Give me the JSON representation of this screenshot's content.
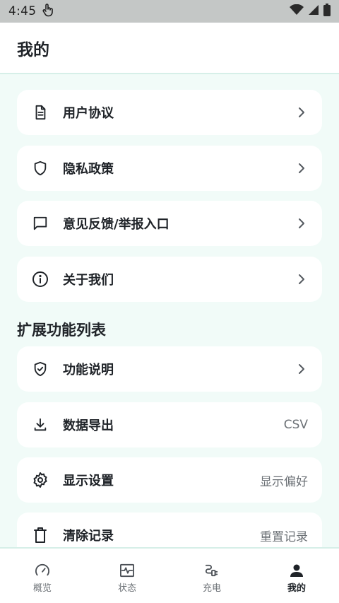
{
  "status_bar": {
    "time": "4:45"
  },
  "header": {
    "title": "我的"
  },
  "menu": [
    {
      "label": "用户协议",
      "icon": "document-icon",
      "chevron": true
    },
    {
      "label": "隐私政策",
      "icon": "shield-icon",
      "chevron": true
    },
    {
      "label": "意见反馈/举报入口",
      "icon": "message-icon",
      "chevron": true
    },
    {
      "label": "关于我们",
      "icon": "info-icon",
      "chevron": true
    }
  ],
  "section": {
    "title": "扩展功能列表"
  },
  "extensions": [
    {
      "label": "功能说明",
      "icon": "shield-check-icon",
      "chevron": true
    },
    {
      "label": "数据导出",
      "icon": "download-icon",
      "value": "CSV"
    },
    {
      "label": "显示设置",
      "icon": "gear-icon",
      "value": "显示偏好"
    },
    {
      "label": "清除记录",
      "icon": "trash-icon",
      "value": "重置记录"
    }
  ],
  "bottom_nav": [
    {
      "label": "概览",
      "icon": "speedometer-icon",
      "active": false
    },
    {
      "label": "状态",
      "icon": "pulse-icon",
      "active": false
    },
    {
      "label": "充电",
      "icon": "charge-plug-icon",
      "active": false
    },
    {
      "label": "我的",
      "icon": "person-icon",
      "active": true
    }
  ]
}
